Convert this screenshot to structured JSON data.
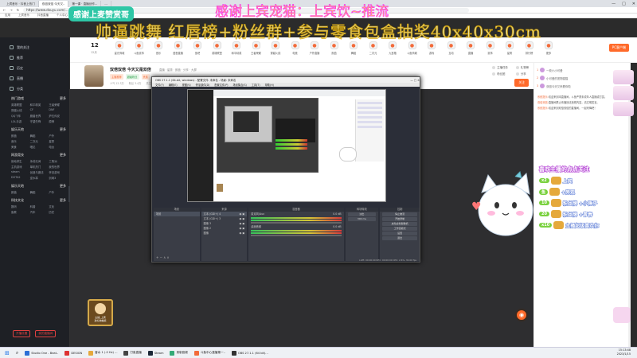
{
  "browser": {
    "tabs": [
      {
        "label": "上宾音乐 · 抖音上热门",
        "active": false
      },
      {
        "label": "双倍双倍 今天又..",
        "active": true
      },
      {
        "label": "第一课 · 直播创作...",
        "active": false
      },
      {
        "label": "...",
        "active": false
      }
    ],
    "url": "https://www.douyu.com/...",
    "bookmarks": [
      "应用",
      "上宾音乐",
      "抖音直播",
      "个人中心",
      "开播工具",
      "数据中心"
    ],
    "window_controls": [
      "—",
      "□",
      "✕"
    ]
  },
  "banner": {
    "badge_text": "感谢上麦赞赏哥",
    "line1": "感谢上宾宠猫：上宾饮~推流",
    "line2": "帅逼跳舞 红唇榜+粉丝群+参与零食包盒抽奖40x40x30cm"
  },
  "sidebar": {
    "nav": [
      {
        "icon": "home-icon",
        "label": "我的关注"
      },
      {
        "icon": "book-icon",
        "label": "推荐"
      },
      {
        "icon": "clock-icon",
        "label": "历史"
      },
      {
        "icon": "play-icon",
        "label": "直播"
      },
      {
        "icon": "star-icon",
        "label": "分类"
      }
    ],
    "groups": [
      {
        "title": "热门游戏",
        "more": "更多",
        "items": [
          "英雄联盟",
          "和平精英",
          "王者荣耀",
          "穿越火线",
          "CF",
          "DNF",
          "QQ飞车",
          "魔兽世界",
          "炉石传说",
          "LOL手游",
          "守望先锋",
          "原神"
        ]
      },
      {
        "title": "娱乐天地",
        "more": "更多",
        "items": [
          "颜值",
          "舞蹈",
          "户外",
          "音乐",
          "二次元",
          "星秀",
          "美食",
          "唱见",
          "电台"
        ]
      },
      {
        "title": "网游竞技",
        "more": "更多",
        "items": [
          "绝地求生",
          "永劫无间",
          "三角洲",
          "主机游戏",
          "单机热门",
          "我的世界",
          "steam",
          "创造与魔法",
          "怀旧游戏",
          "DOTA2",
          "逆水寒",
          "剑网3"
        ]
      },
      {
        "title": "娱乐天地",
        "more": "更多",
        "items": [
          "颜值",
          "舞蹈",
          "户外"
        ]
      },
      {
        "title": "科技文化",
        "more": "更多",
        "items": [
          "数码",
          "科普",
          "文化",
          "鱼教",
          "汽车",
          "历史"
        ]
      }
    ],
    "buttons": [
      "开播设置",
      "我的直播间"
    ]
  },
  "topnav": {
    "date_num": "12",
    "date_label": "12月",
    "items": [
      "星光商城",
      "斗鱼赛事",
      "音乐",
      "语音直播",
      "鱼吧",
      "英雄联盟",
      "和平精英",
      "王者荣耀",
      "穿越火线",
      "电竞",
      "户外直播",
      "颜值",
      "舞蹈",
      "二次元",
      "九宫格",
      "斗鱼商城",
      "游戏",
      "互动",
      "直播",
      "赛事",
      "星秀",
      "排行榜",
      "更多"
    ],
    "pc_button": "PC客户端"
  },
  "room": {
    "title": "双倍双倍 今天又是双倍",
    "meta": "直播 · 星秀 · 颜值 · 分享 · 大屏",
    "tags": [
      "主播推荐",
      "超级粉丝",
      "贵族"
    ],
    "stats": [
      "人气 12.3万",
      "粉丝 3.4万",
      "关注 2"
    ],
    "right_items": [
      "主播任务",
      "礼物榜",
      "粉丝团",
      "分享"
    ],
    "follow_label": "关注"
  },
  "obs": {
    "title": "OBS 27.1.1 (64-bit, windows) - 配置文件: 未命名 - 场景: 未命名",
    "menu": [
      "文件(F)",
      "编辑(E)",
      "视图(V)",
      "停靠部件(D)",
      "配置文件(P)",
      "场景集合(S)",
      "工具(T)",
      "帮助(H)"
    ],
    "scenes_header": "场景",
    "scenes": [
      "场景"
    ],
    "sources_header": "来源",
    "sources": [
      "文本 (GDI+) 4",
      "文本 (GDI+) 3",
      "图像 3",
      "图像 2",
      "图像"
    ],
    "mixer_header": "混音器",
    "mixer": [
      {
        "name": "麦克风/Aux",
        "db": "0.0 dB"
      },
      {
        "name": "桌面音频",
        "db": "0.0 dB"
      }
    ],
    "transitions_header": "转场特效",
    "transition_mode": "淡出",
    "transition_duration": "300 ms",
    "controls_header": "控制",
    "controls": [
      "停止推流",
      "开始录制",
      "启动虚拟摄像机",
      "工作室模式",
      "设置",
      "退出"
    ],
    "status": "LIVE: 00:00:00   REC: 00:00:00   CPU: 2.6%, 30.00 fps"
  },
  "chat": {
    "ranks": [
      {
        "name": "一枚小小可爱",
        "badge": "1"
      },
      {
        "name": "小可爱的宠物猫猫",
        "badge": "2"
      },
      {
        "name": "双倍今天又来看你啦",
        "badge": "3"
      }
    ],
    "messages": [
      {
        "user": "系统提示:",
        "text": "欢迎来到本直播间，斗鱼严禁未成年人直播或打赏。"
      },
      {
        "user": "双倍双倍:",
        "text": "直播间禁止传播违法违规内容，请文明发言。"
      },
      {
        "user": "系统提示:",
        "text": "欢迎来到双倍双倍的直播间，一起来嗨吧！"
      }
    ]
  },
  "promo": {
    "title": "喜欢主播的点点关注",
    "lines": [
      {
        "prefix": "x2",
        "text": "上宾"
      },
      {
        "prefix": "鱼",
        "text": "+旁观"
      },
      {
        "prefix": "10",
        "text": "粉丝牌 +小锤子"
      },
      {
        "prefix": "20",
        "text": "粉丝牌 +青春"
      },
      {
        "prefix": "x10",
        "text": "主播超级喜欢你"
      }
    ]
  },
  "card": {
    "text": "主播_上宾",
    "sub": "送礼物抽奖"
  },
  "taskbar": {
    "items": [
      "Studio One - Beat..",
      "DESIGN",
      "香水 1 (.0 Hz) ...",
      "打鱼直播",
      "Steam",
      "录制音频",
      "斗鱼中心直播第一..",
      "OBS 27.1.1 (64 bit)..."
    ],
    "time": "15:13:48",
    "date": "2023/1/15"
  },
  "colors": {
    "accent": "#ff6a2a",
    "page_bg": "#2b2b2b",
    "sidebar_bg": "#1e2025",
    "obs_bg": "#2b2e38"
  }
}
